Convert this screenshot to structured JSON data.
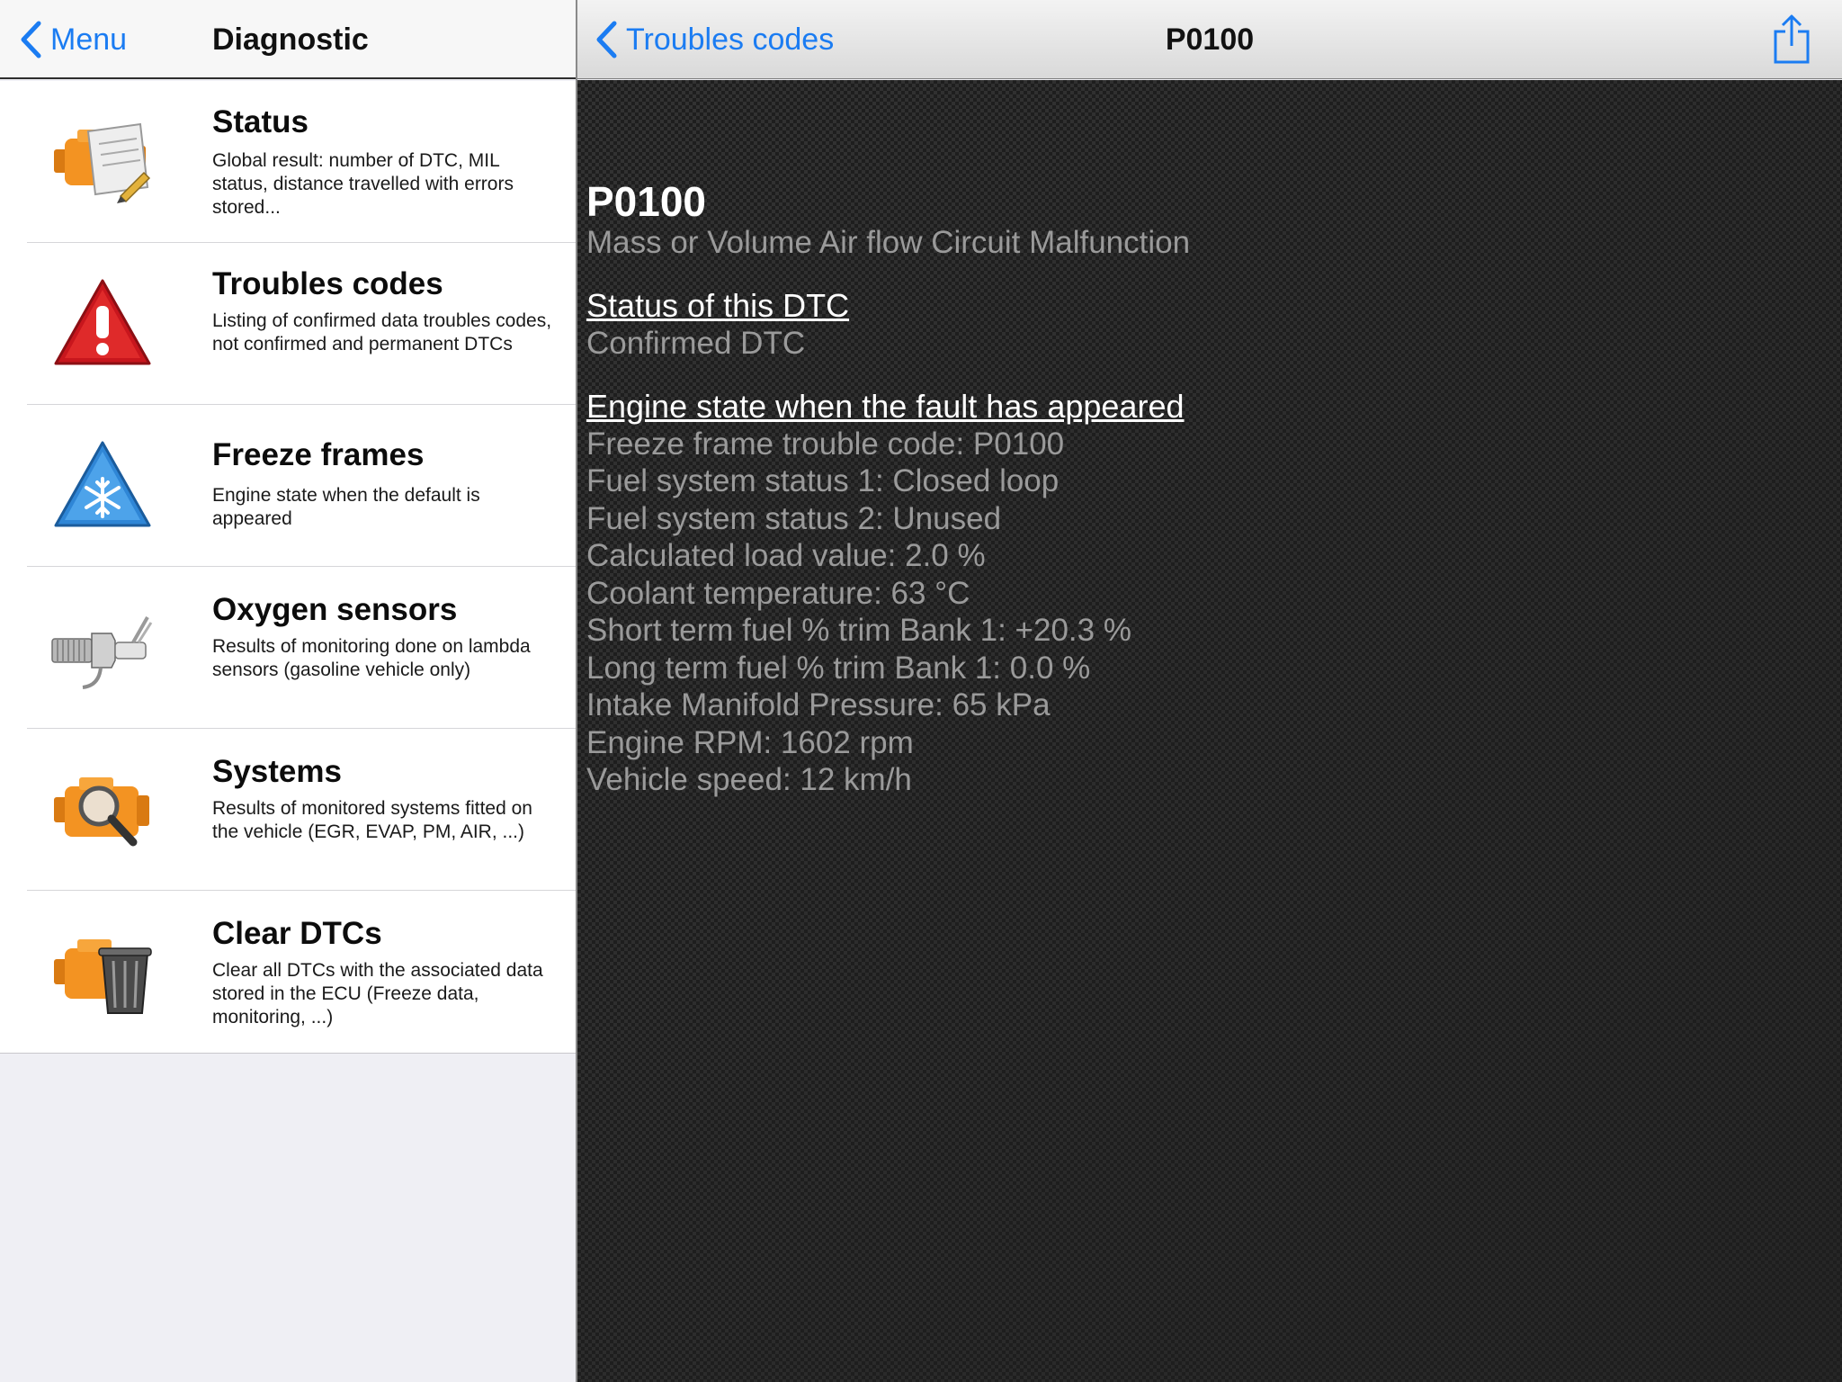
{
  "left_nav": {
    "back_label": "Menu",
    "title": "Diagnostic"
  },
  "menu": [
    {
      "icon": "engine-document-icon",
      "title": "Status",
      "desc": "Global result: number of DTC, MIL status, distance travelled with errors stored..."
    },
    {
      "icon": "warning-triangle-icon",
      "title": "Troubles codes",
      "desc": "Listing of confirmed data troubles codes, not confirmed and permanent DTCs"
    },
    {
      "icon": "snowflake-triangle-icon",
      "title": "Freeze frames",
      "desc": "Engine state when the default is appeared"
    },
    {
      "icon": "oxygen-sensor-icon",
      "title": "Oxygen sensors",
      "desc": "Results of monitoring done on lambda sensors (gasoline vehicle only)"
    },
    {
      "icon": "engine-magnifier-icon",
      "title": "Systems",
      "desc": "Results of monitored systems fitted on the vehicle (EGR, EVAP, PM, AIR, ...)"
    },
    {
      "icon": "engine-trash-icon",
      "title": "Clear DTCs",
      "desc": "Clear all DTCs with the associated data stored in the ECU (Freeze data, monitoring, ...)"
    }
  ],
  "right_nav": {
    "back_label": "Troubles codes",
    "title": "P0100",
    "share_icon": "share-icon"
  },
  "detail": {
    "code": "P0100",
    "description": "Mass or Volume Air flow Circuit Malfunction",
    "status_heading": "Status of this DTC",
    "status_value": "Confirmed DTC",
    "engine_heading": "Engine state when the fault has appeared",
    "engine_lines": [
      "Freeze frame trouble code: P0100",
      "Fuel system status 1: Closed loop",
      "Fuel system status 2: Unused",
      "Calculated load value: 2.0 %",
      "Coolant temperature: 63 °C",
      "Short term fuel % trim Bank 1: +20.3 %",
      "Long term fuel % trim Bank 1: 0.0 %",
      "Intake Manifold Pressure: 65 kPa",
      "Engine RPM: 1602 rpm",
      "Vehicle speed: 12 km/h"
    ]
  },
  "colors": {
    "accent": "#1b7cf2",
    "engine_orange": "#f39322",
    "warning_red": "#c8161d",
    "freeze_blue": "#2f86d6"
  }
}
